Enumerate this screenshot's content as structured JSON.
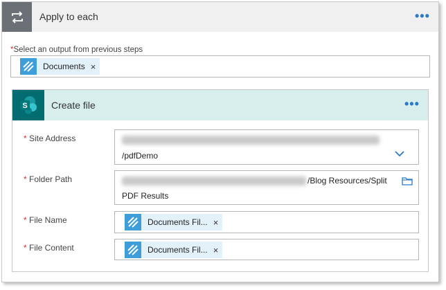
{
  "apply_to_each": {
    "title": "Apply to each",
    "menu_glyph": "•••",
    "output_label": "Select an output from previous steps",
    "required_marker": "*",
    "token": {
      "label": "Documents",
      "remove": "×"
    }
  },
  "create_file": {
    "title": "Create file",
    "menu_glyph": "•••",
    "fields": {
      "site_address": {
        "label": "Site Address",
        "value": "/pdfDemo"
      },
      "folder_path": {
        "label": "Folder Path",
        "value_line1": "/Blog Resources/Split",
        "value_line2": "PDF Results"
      },
      "file_name": {
        "label": "File Name",
        "token": "Documents Fil...",
        "remove": "×"
      },
      "file_content": {
        "label": "File Content",
        "token": "Documents Fil...",
        "remove": "×"
      }
    }
  },
  "colors": {
    "accent": "#2a7ac8",
    "apply_icon_bg": "#6b7077",
    "sharepoint": "#036c70",
    "token_icon": "#3d9ed9",
    "token_bg": "#e3f1fa",
    "required": "#cc3333"
  },
  "icons": [
    "loop-icon",
    "more-options-icon",
    "token-data-icon",
    "sharepoint-logo-icon",
    "chevron-down-icon",
    "folder-icon",
    "remove-token-icon"
  ]
}
